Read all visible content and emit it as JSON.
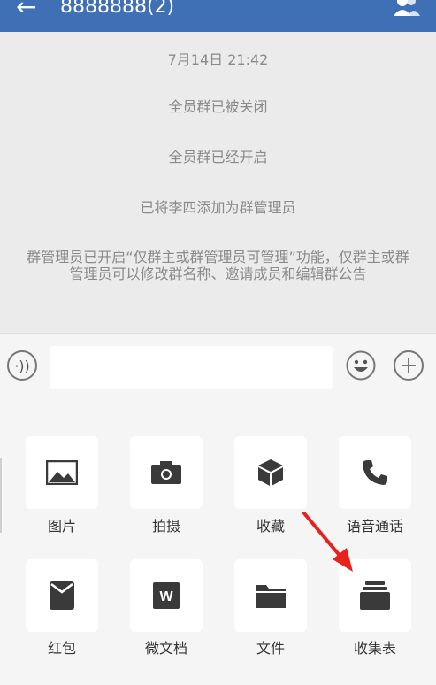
{
  "header": {
    "title": "8888888(2)"
  },
  "messages": [
    "7月14日  21:42",
    "全员群已被关闭",
    "全员群已经开启",
    "已将李四添加为群管理员",
    "群管理员已开启“仅群主或群管理员可管理”功能，仅群主或群管理员可以修改群名称、邀请成员和编辑群公告"
  ],
  "input": {
    "placeholder": ""
  },
  "tools": [
    {
      "label": "图片",
      "icon": "image-icon"
    },
    {
      "label": "拍摄",
      "icon": "camera-icon"
    },
    {
      "label": "收藏",
      "icon": "favorite-box-icon"
    },
    {
      "label": "语音通话",
      "icon": "phone-icon"
    },
    {
      "label": "红包",
      "icon": "red-packet-icon"
    },
    {
      "label": "微文档",
      "icon": "wdoc-icon"
    },
    {
      "label": "文件",
      "icon": "folder-icon"
    },
    {
      "label": "收集表",
      "icon": "collection-form-icon"
    }
  ],
  "colors": {
    "header": "#3f6fb5",
    "icon": "#3a3a3a",
    "arrow": "#e8211e"
  }
}
